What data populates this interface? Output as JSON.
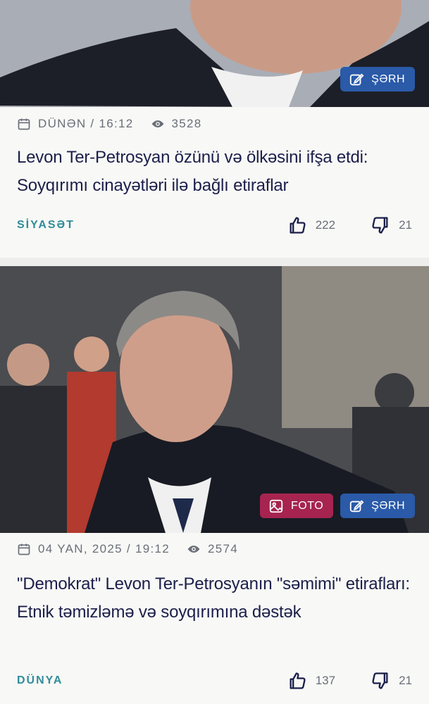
{
  "articles": [
    {
      "photo": "Close-up of a man in a dark suit and white shirt",
      "badges": {
        "comment": "ŞƏRH"
      },
      "date": "DÜNƏN / 16:12",
      "views": "3528",
      "title": "Levon Ter-Petrosyan özünü və ölkəsini ifşa etdi: Soyqırımı cinayətləri ilə bağlı etiraflar",
      "category": "SİYASƏT",
      "likes": "222",
      "dislikes": "21"
    },
    {
      "photo": "Elderly man in a dark suit in front of a crowd",
      "badges": {
        "foto": "FOTO",
        "comment": "ŞƏRH"
      },
      "date": "04 YAN, 2025 / 19:12",
      "views": "2574",
      "title": "\"Demokrat\" Levon Ter-Petrosyanın \"səmimi\" etirafları: Etnik təmizləmə və soyqırımına dəstək",
      "category": "DÜNYA",
      "likes": "137",
      "dislikes": "21"
    }
  ],
  "icons": {
    "calendar": "calendar-icon",
    "eye": "eye-icon",
    "comment": "edit-square-icon",
    "foto": "image-icon",
    "like": "thumbs-up-icon",
    "dislike": "thumbs-down-icon"
  },
  "colors": {
    "comment_badge": "#2a5aa8",
    "foto_badge": "#a6244f",
    "category": "#2f8d9a",
    "title": "#1b1f4a",
    "meta": "#6a6e78"
  }
}
